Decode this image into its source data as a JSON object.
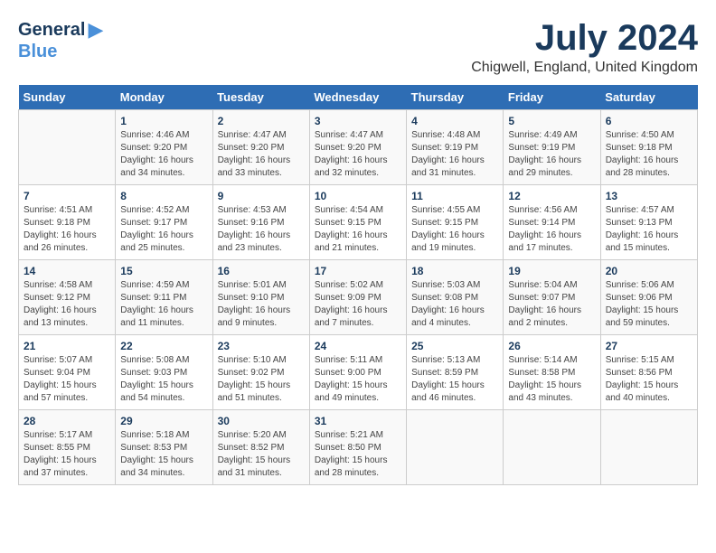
{
  "header": {
    "logo_general": "General",
    "logo_blue": "Blue",
    "month_year": "July 2024",
    "location": "Chigwell, England, United Kingdom"
  },
  "calendar": {
    "days_of_week": [
      "Sunday",
      "Monday",
      "Tuesday",
      "Wednesday",
      "Thursday",
      "Friday",
      "Saturday"
    ],
    "weeks": [
      [
        {
          "day": "",
          "detail": ""
        },
        {
          "day": "1",
          "detail": "Sunrise: 4:46 AM\nSunset: 9:20 PM\nDaylight: 16 hours\nand 34 minutes."
        },
        {
          "day": "2",
          "detail": "Sunrise: 4:47 AM\nSunset: 9:20 PM\nDaylight: 16 hours\nand 33 minutes."
        },
        {
          "day": "3",
          "detail": "Sunrise: 4:47 AM\nSunset: 9:20 PM\nDaylight: 16 hours\nand 32 minutes."
        },
        {
          "day": "4",
          "detail": "Sunrise: 4:48 AM\nSunset: 9:19 PM\nDaylight: 16 hours\nand 31 minutes."
        },
        {
          "day": "5",
          "detail": "Sunrise: 4:49 AM\nSunset: 9:19 PM\nDaylight: 16 hours\nand 29 minutes."
        },
        {
          "day": "6",
          "detail": "Sunrise: 4:50 AM\nSunset: 9:18 PM\nDaylight: 16 hours\nand 28 minutes."
        }
      ],
      [
        {
          "day": "7",
          "detail": "Sunrise: 4:51 AM\nSunset: 9:18 PM\nDaylight: 16 hours\nand 26 minutes."
        },
        {
          "day": "8",
          "detail": "Sunrise: 4:52 AM\nSunset: 9:17 PM\nDaylight: 16 hours\nand 25 minutes."
        },
        {
          "day": "9",
          "detail": "Sunrise: 4:53 AM\nSunset: 9:16 PM\nDaylight: 16 hours\nand 23 minutes."
        },
        {
          "day": "10",
          "detail": "Sunrise: 4:54 AM\nSunset: 9:15 PM\nDaylight: 16 hours\nand 21 minutes."
        },
        {
          "day": "11",
          "detail": "Sunrise: 4:55 AM\nSunset: 9:15 PM\nDaylight: 16 hours\nand 19 minutes."
        },
        {
          "day": "12",
          "detail": "Sunrise: 4:56 AM\nSunset: 9:14 PM\nDaylight: 16 hours\nand 17 minutes."
        },
        {
          "day": "13",
          "detail": "Sunrise: 4:57 AM\nSunset: 9:13 PM\nDaylight: 16 hours\nand 15 minutes."
        }
      ],
      [
        {
          "day": "14",
          "detail": "Sunrise: 4:58 AM\nSunset: 9:12 PM\nDaylight: 16 hours\nand 13 minutes."
        },
        {
          "day": "15",
          "detail": "Sunrise: 4:59 AM\nSunset: 9:11 PM\nDaylight: 16 hours\nand 11 minutes."
        },
        {
          "day": "16",
          "detail": "Sunrise: 5:01 AM\nSunset: 9:10 PM\nDaylight: 16 hours\nand 9 minutes."
        },
        {
          "day": "17",
          "detail": "Sunrise: 5:02 AM\nSunset: 9:09 PM\nDaylight: 16 hours\nand 7 minutes."
        },
        {
          "day": "18",
          "detail": "Sunrise: 5:03 AM\nSunset: 9:08 PM\nDaylight: 16 hours\nand 4 minutes."
        },
        {
          "day": "19",
          "detail": "Sunrise: 5:04 AM\nSunset: 9:07 PM\nDaylight: 16 hours\nand 2 minutes."
        },
        {
          "day": "20",
          "detail": "Sunrise: 5:06 AM\nSunset: 9:06 PM\nDaylight: 15 hours\nand 59 minutes."
        }
      ],
      [
        {
          "day": "21",
          "detail": "Sunrise: 5:07 AM\nSunset: 9:04 PM\nDaylight: 15 hours\nand 57 minutes."
        },
        {
          "day": "22",
          "detail": "Sunrise: 5:08 AM\nSunset: 9:03 PM\nDaylight: 15 hours\nand 54 minutes."
        },
        {
          "day": "23",
          "detail": "Sunrise: 5:10 AM\nSunset: 9:02 PM\nDaylight: 15 hours\nand 51 minutes."
        },
        {
          "day": "24",
          "detail": "Sunrise: 5:11 AM\nSunset: 9:00 PM\nDaylight: 15 hours\nand 49 minutes."
        },
        {
          "day": "25",
          "detail": "Sunrise: 5:13 AM\nSunset: 8:59 PM\nDaylight: 15 hours\nand 46 minutes."
        },
        {
          "day": "26",
          "detail": "Sunrise: 5:14 AM\nSunset: 8:58 PM\nDaylight: 15 hours\nand 43 minutes."
        },
        {
          "day": "27",
          "detail": "Sunrise: 5:15 AM\nSunset: 8:56 PM\nDaylight: 15 hours\nand 40 minutes."
        }
      ],
      [
        {
          "day": "28",
          "detail": "Sunrise: 5:17 AM\nSunset: 8:55 PM\nDaylight: 15 hours\nand 37 minutes."
        },
        {
          "day": "29",
          "detail": "Sunrise: 5:18 AM\nSunset: 8:53 PM\nDaylight: 15 hours\nand 34 minutes."
        },
        {
          "day": "30",
          "detail": "Sunrise: 5:20 AM\nSunset: 8:52 PM\nDaylight: 15 hours\nand 31 minutes."
        },
        {
          "day": "31",
          "detail": "Sunrise: 5:21 AM\nSunset: 8:50 PM\nDaylight: 15 hours\nand 28 minutes."
        },
        {
          "day": "",
          "detail": ""
        },
        {
          "day": "",
          "detail": ""
        },
        {
          "day": "",
          "detail": ""
        }
      ]
    ]
  }
}
